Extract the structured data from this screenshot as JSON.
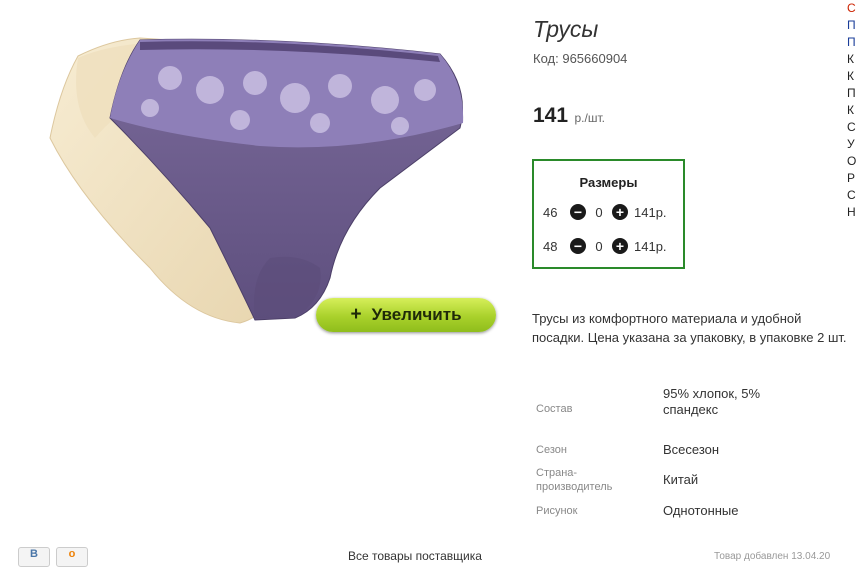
{
  "product": {
    "title": "Трусы",
    "code_label": "Код:",
    "code": "965660904",
    "price_value": "141",
    "price_unit": "р./шт.",
    "zoom_label": "Увеличить",
    "description": "Трусы из комфортного материала и удобной посадки. Цена указана за упаковку, в упаковке 2 шт."
  },
  "sizes": {
    "title": "Размеры",
    "rows": [
      {
        "size": "46",
        "qty": "0",
        "price": "141р."
      },
      {
        "size": "48",
        "qty": "0",
        "price": "141р."
      }
    ]
  },
  "properties": [
    {
      "name": "Состав",
      "value": "95% хлопок, 5% спандекс"
    },
    {
      "name": "Сезон",
      "value": "Всесезон"
    },
    {
      "name": "Страна-производитель",
      "value": "Китай"
    },
    {
      "name": "Рисунок",
      "value": "Однотонные"
    }
  ],
  "right_menu": [
    "С",
    "П",
    "П",
    "К",
    "К",
    "П",
    "К",
    "С",
    "У",
    "О",
    "Р",
    "С",
    "Н"
  ],
  "right_menu_colors": [
    "#cc2200",
    "#1a3d99",
    "#1a3d99"
  ],
  "share": [
    "В",
    "о"
  ],
  "footer": {
    "link": "Все товары поставщика",
    "date": "Товар добавлен 13.04.20"
  },
  "colors": {
    "accent_green": "#2a8a2a",
    "zoom_button": "#a9d12b",
    "panty_purple": "#6e5d8f",
    "panty_cream": "#f3e6c8"
  }
}
